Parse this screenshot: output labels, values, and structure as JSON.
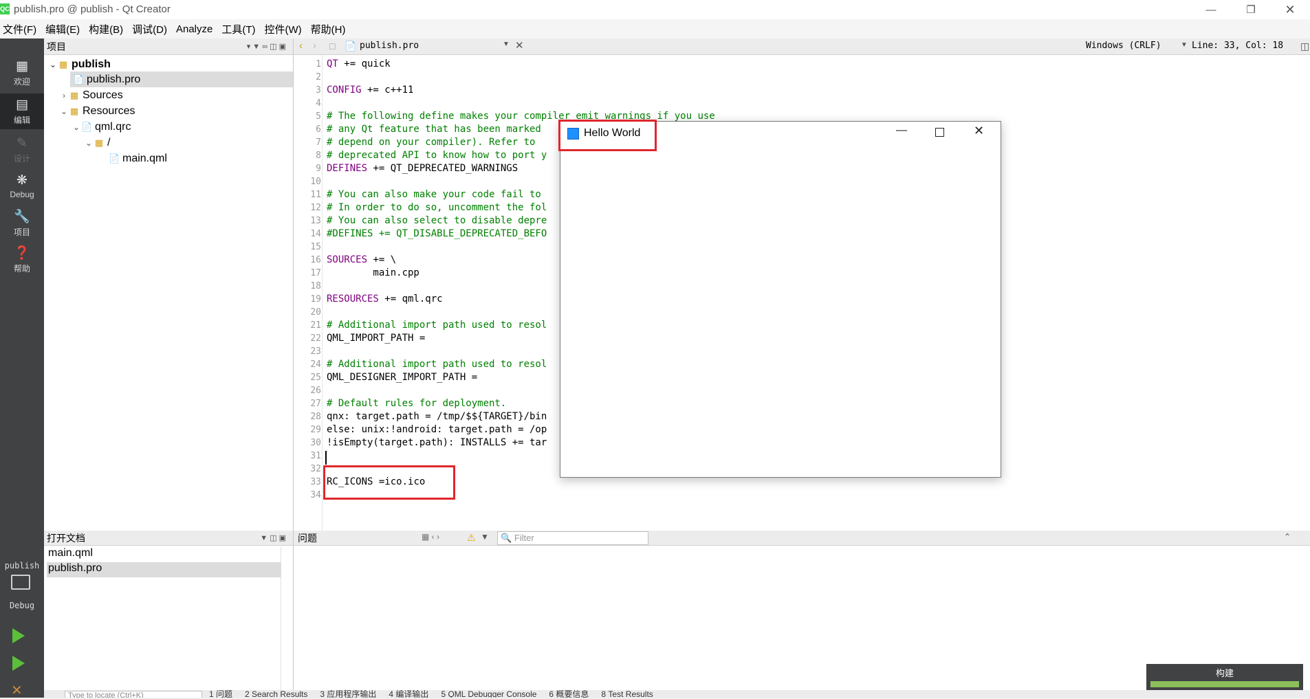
{
  "window": {
    "title": "publish.pro @ publish - Qt Creator",
    "app_icon_text": "QC"
  },
  "menubar": [
    "文件(F)",
    "编辑(E)",
    "构建(B)",
    "调试(D)",
    "Analyze",
    "工具(T)",
    "控件(W)",
    "帮助(H)"
  ],
  "modes": [
    {
      "label": "欢迎",
      "icon": "grid-icon"
    },
    {
      "label": "编辑",
      "icon": "edit-icon"
    },
    {
      "label": "设计",
      "icon": "pencil-icon"
    },
    {
      "label": "Debug",
      "icon": "bug-icon"
    },
    {
      "label": "项目",
      "icon": "wrench-icon"
    },
    {
      "label": "帮助",
      "icon": "help-icon"
    }
  ],
  "kit": {
    "project": "publish",
    "build": "Debug"
  },
  "project_panel": {
    "title": "项目",
    "tree": [
      "publish",
      "publish.pro",
      "Sources",
      "Resources",
      "qml.qrc",
      "/",
      "main.qml"
    ]
  },
  "editor": {
    "file": "publish.pro",
    "line_ending": "Windows (CRLF)",
    "cursor": "Line: 33, Col: 18",
    "lines": [
      "QT += quick",
      "",
      "CONFIG += c++11",
      "",
      "# The following define makes your compiler emit warnings if you use",
      "# any Qt feature that has been marked",
      "# depend on your compiler). Refer to",
      "# deprecated API to know how to port y",
      "DEFINES += QT_DEPRECATED_WARNINGS",
      "",
      "# You can also make your code fail to",
      "# In order to do so, uncomment the fol",
      "# You can also select to disable depre",
      "#DEFINES += QT_DISABLE_DEPRECATED_BEFO",
      "",
      "SOURCES += \\",
      "        main.cpp",
      "",
      "RESOURCES += qml.qrc",
      "",
      "# Additional import path used to resol",
      "QML_IMPORT_PATH =",
      "",
      "# Additional import path used to resol",
      "QML_DESIGNER_IMPORT_PATH =",
      "",
      "# Default rules for deployment.",
      "qnx: target.path = /tmp/$${TARGET}/bin",
      "else: unix:!android: target.path = /op",
      "!isEmpty(target.path): INSTALLS += tar",
      "",
      "",
      "RC_ICONS =ico.ico",
      ""
    ]
  },
  "open_docs": {
    "title": "打开文档",
    "items": [
      "main.qml",
      "publish.pro"
    ]
  },
  "issues": {
    "title": "问题",
    "filter_placeholder": "Filter"
  },
  "build_progress": {
    "label": "构建",
    "value": 1.0
  },
  "bottom_bar": {
    "locator_placeholder": "Type to locate (Ctrl+K)",
    "tabs": [
      "1 问题",
      "2 Search Results",
      "3 应用程序输出",
      "4 编译输出",
      "5 QML Debugger Console",
      "6 概要信息",
      "8 Test Results"
    ]
  },
  "hello_window": {
    "title": "Hello World"
  },
  "colors": {
    "accent_red": "#e0262d",
    "keyword": "#800080",
    "comment": "#008000",
    "sidebar_bg": "#404244",
    "progress_green": "#8cbf5a"
  }
}
